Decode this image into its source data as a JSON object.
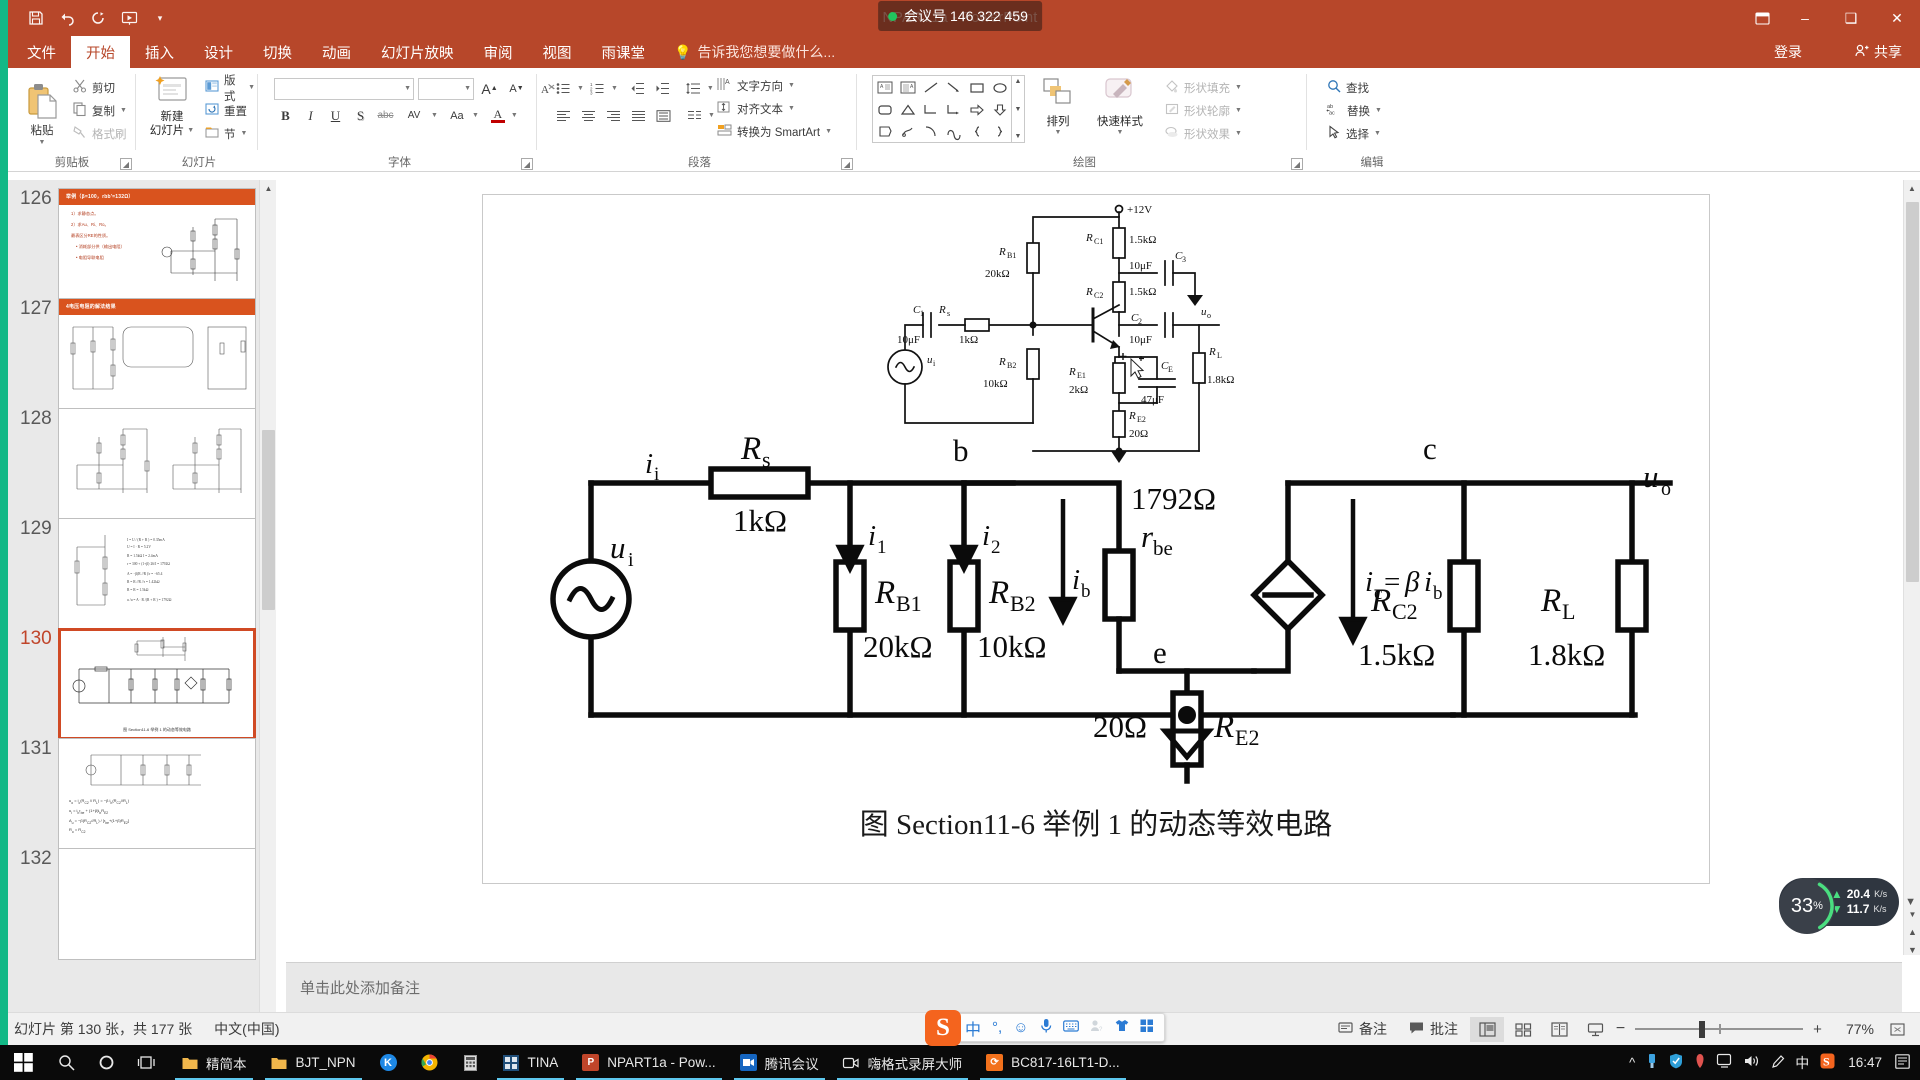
{
  "window": {
    "title": "NPART1a - PowerPoint",
    "meeting_badge": "会议号 146 322 459",
    "minimize": "–",
    "maximize": "❑",
    "close": "✕",
    "ribbon_display": "ribbon-display-options-icon"
  },
  "quick_access": {
    "save": "save-icon",
    "undo": "undo-icon",
    "redo": "redo-icon",
    "start_slideshow": "start-from-beginning-icon",
    "more": "▾"
  },
  "tabs": [
    {
      "label": "文件",
      "active": false
    },
    {
      "label": "开始",
      "active": true
    },
    {
      "label": "插入",
      "active": false
    },
    {
      "label": "设计",
      "active": false
    },
    {
      "label": "切换",
      "active": false
    },
    {
      "label": "动画",
      "active": false
    },
    {
      "label": "幻灯片放映",
      "active": false
    },
    {
      "label": "审阅",
      "active": false
    },
    {
      "label": "视图",
      "active": false
    },
    {
      "label": "雨课堂",
      "active": false
    }
  ],
  "tell_me": "告诉我您想要做什么...",
  "sign_in": "登录",
  "share": "共享",
  "ribbon": {
    "groups": [
      {
        "name": "剪贴板"
      },
      {
        "name": "幻灯片"
      },
      {
        "name": "字体"
      },
      {
        "name": "段落"
      },
      {
        "name": "绘图"
      },
      {
        "name": "编辑"
      }
    ],
    "clipboard": {
      "paste": "粘贴",
      "cut": "剪切",
      "copy": "复制",
      "format_painter": "格式刷"
    },
    "slides": {
      "new_slide_l1": "新建",
      "new_slide_l2": "幻灯片",
      "layout": "版式",
      "reset": "重置",
      "section": "节"
    },
    "font": {
      "font_name": "",
      "font_size": "",
      "grow": "A",
      "shrink": "A",
      "clear_format": "clear-formatting-icon",
      "bold": "B",
      "italic": "I",
      "underline": "U",
      "shadow": "S",
      "strikethrough": "abc",
      "spacing": "AV",
      "change_case": "Aa",
      "font_color": "A"
    },
    "paragraph": {
      "text_direction": "文字方向",
      "align_text": "对齐文本",
      "convert_smartart": "转换为 SmartArt"
    },
    "drawing": {
      "arrange": "排列",
      "quick_styles": "快速样式",
      "shape_fill": "形状填充",
      "shape_outline": "形状轮廓",
      "shape_effects": "形状效果"
    },
    "editing": {
      "find": "查找",
      "replace": "替换",
      "select": "选择"
    }
  },
  "thumbnails": [
    {
      "number": "126",
      "selected": false,
      "title": "举例（β=100，rbb'=132Ω）",
      "lines": [
        "1）求静态点。",
        "2）求Au、Ri、Ro。",
        "最表区分RE的性质。",
        "• 消耗部分供（输出电阻）",
        "• 电阻导联电阻"
      ]
    },
    {
      "number": "127",
      "selected": false,
      "title": "4电压电阻的解法结果",
      "lines": []
    },
    {
      "number": "128",
      "selected": false,
      "title": "",
      "lines": []
    },
    {
      "number": "129",
      "selected": false,
      "title": "",
      "lines": []
    },
    {
      "number": "130",
      "selected": true,
      "title": "",
      "lines": []
    },
    {
      "number": "131",
      "selected": false,
      "title": "",
      "lines": []
    },
    {
      "number": "132",
      "selected": false,
      "title": "",
      "lines": []
    }
  ],
  "notes_placeholder": "单击此处添加备注",
  "status": {
    "slide_info": "幻灯片 第 130 张，共 177 张",
    "language": "中文(中国)",
    "notes_button": "备注",
    "comments_button": "批注",
    "zoom_percent": "77%",
    "views": [
      "normal-view-icon",
      "slide-sorter-icon",
      "reading-view-icon",
      "slideshow-icon"
    ],
    "fit_slide": "fit-slide-to-window-icon"
  },
  "taskbar": {
    "start": "start-icon",
    "search": "search-icon",
    "cortana": "cortana-icon",
    "task_view": "task-view-icon",
    "items": [
      {
        "label": "精简本",
        "icon": "folder-icon",
        "open": true
      },
      {
        "label": "BJT_NPN",
        "icon": "folder-icon",
        "open": true
      },
      {
        "label": "",
        "icon": "kingsoft-icon",
        "open": false
      },
      {
        "label": "",
        "icon": "chrome-icon",
        "open": false
      },
      {
        "label": "",
        "icon": "calculator-icon",
        "open": false
      },
      {
        "label": "TINA",
        "icon": "tina-icon",
        "open": true
      },
      {
        "label": "NPART1a - Pow...",
        "icon": "powerpoint-icon",
        "open": true
      },
      {
        "label": "腾讯会议",
        "icon": "tencent-meeting-icon",
        "open": true
      },
      {
        "label": "嗨格式录屏大师",
        "icon": "screen-recorder-icon",
        "open": true
      },
      {
        "label": "BC817-16LT1-D...",
        "icon": "pdf-icon",
        "open": true
      }
    ],
    "tray": [
      "chevron-up-icon",
      "usb-icon",
      "shield-icon",
      "red-icon",
      "display-icon",
      "volume-icon",
      "pen-icon",
      "中",
      "sogou-icon"
    ],
    "clock": "16:47",
    "action_center": "action-center-icon"
  },
  "ime_bar": {
    "logo": "S",
    "items": [
      "中",
      "°,",
      "☺",
      "mic-icon",
      "keyboard-icon",
      "user-icon",
      "skin-icon",
      "apps-icon"
    ]
  },
  "net_widget": {
    "percent": "33",
    "percent_unit": "%",
    "up": "20.4",
    "up_unit": "K/s",
    "down": "11.7",
    "down_unit": "K/s",
    "chevron": "▼"
  },
  "slide": {
    "caption": "图 Section11-6  举例 1 的动态等效电路",
    "top_circuit": {
      "supply": "+12V",
      "C1": "C₁",
      "C1_val": "10μF",
      "Rs": "R",
      "Rs_sub": "s",
      "Rs_val": "1kΩ",
      "ui": "u",
      "ui_sub": "i",
      "RB1": "R",
      "RB1_sub": "B1",
      "RB1_val": "20kΩ",
      "RB2": "R",
      "RB2_sub": "B2",
      "RB2_val": "10kΩ",
      "RC1": "R",
      "RC1_sub": "C1",
      "RC1_val": "1.5kΩ",
      "RC2": "R",
      "RC2_sub": "C2",
      "RC2_val": "1.5kΩ",
      "C3": "C₃",
      "C3_val": "10μF",
      "C2": "C₂",
      "C2_val": "10μF",
      "uo": "u",
      "uo_sub": "o",
      "RE1": "R",
      "RE1_sub": "E1",
      "RE1_val": "2kΩ",
      "CE": "C",
      "CE_sub": "E",
      "CE_val": "47μF",
      "RE2": "R",
      "RE2_sub": "E2",
      "RE2_val": "20Ω",
      "RL": "R",
      "RL_sub": "L",
      "RL_val": "1.8kΩ"
    },
    "bottom_circuit": {
      "ii": "i",
      "ii_sub": "i",
      "Rs": "R",
      "Rs_sub": "s",
      "Rs_val": "1kΩ",
      "ui": "u",
      "ui_sub": "i",
      "i1": "i",
      "i1_sub": "1",
      "i2": "i",
      "i2_sub": "2",
      "RB1": "R",
      "RB1_sub": "B1",
      "RB1_val": "20kΩ",
      "RB2": "R",
      "RB2_sub": "B2",
      "RB2_val": "10kΩ",
      "node_b": "b",
      "node_c": "c",
      "node_e": "e",
      "ib": "i",
      "ib_sub": "b",
      "rbe": "r",
      "rbe_sub": "be",
      "rbe_val": "1792Ω",
      "ic": "i",
      "ic_sub": "c",
      "ic_expr": "=βi",
      "ic_expr_sub": "b",
      "RC2": "R",
      "RC2_sub": "C2",
      "RC2_val": "1.5kΩ",
      "RL": "R",
      "RL_sub": "L",
      "RL_val": "1.8kΩ",
      "RE2": "R",
      "RE2_sub": "E2",
      "RE2_val": "20Ω",
      "uo": "u",
      "uo_sub": "o"
    }
  }
}
